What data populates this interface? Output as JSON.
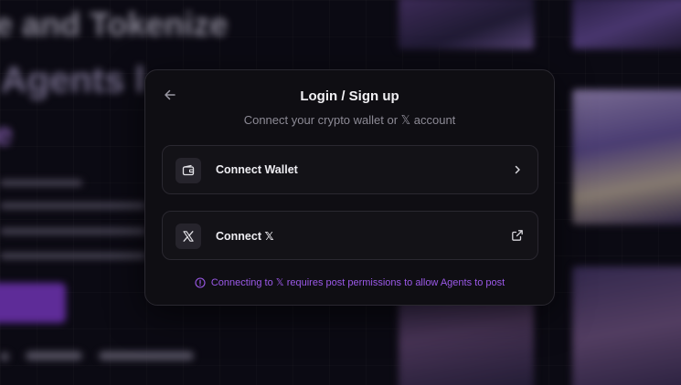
{
  "background": {
    "hero_line1": "e and Tokenize",
    "hero_line2": "I Agents l",
    "hero_line3": "e"
  },
  "modal": {
    "title": "Login / Sign up",
    "subtitle": "Connect your crypto wallet or 𝕏 account",
    "options": [
      {
        "label": "Connect Wallet",
        "icon": "wallet-icon",
        "trailing_icon": "chevron-right-icon"
      },
      {
        "label": "Connect 𝕏",
        "icon": "x-logo-icon",
        "trailing_icon": "external-link-icon"
      }
    ],
    "notice": "Connecting to 𝕏 requires post permissions to allow Agents to post"
  },
  "colors": {
    "accent": "#9b59e8",
    "modal_bg": "#0f0e13",
    "option_bg": "#131217",
    "border": "#2a2830"
  }
}
